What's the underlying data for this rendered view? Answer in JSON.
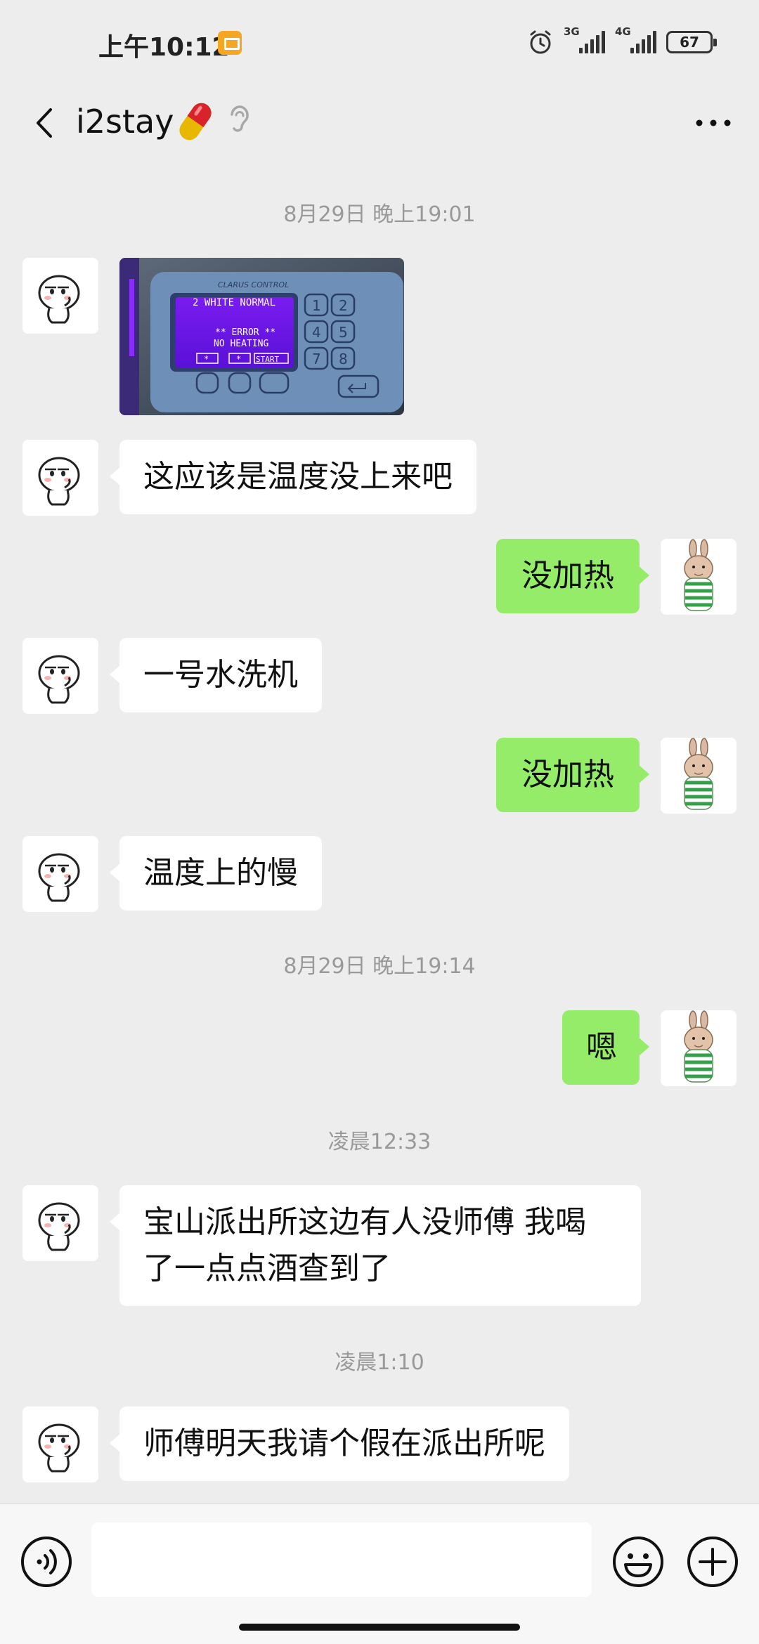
{
  "status_bar": {
    "time": "上午10:12",
    "signal1_label": "3G",
    "signal2_label": "4G",
    "battery": "67"
  },
  "header": {
    "title": "i2stay",
    "title_icons": [
      "pill-icon",
      "ear-icon"
    ]
  },
  "photo": {
    "panel_brand": "CLARUS CONTROL",
    "screen_line1": "2 WHITE  NORMAL",
    "screen_line2": "** ERROR **",
    "screen_line3": "NO HEATING",
    "soft_key1": "*",
    "soft_key2": "*",
    "soft_key3": "START",
    "keys": [
      "1",
      "2",
      "4",
      "5",
      "7",
      "8"
    ]
  },
  "messages": {
    "ts1": "8月29日 晚上19:01",
    "m2": "这应该是温度没上来吧",
    "m3": "没加热",
    "m4": "一号水洗机",
    "m5": "没加热",
    "m6": "温度上的慢",
    "ts2": "8月29日 晚上19:14",
    "m7": "嗯",
    "ts3": "凌晨12:33",
    "m8_line1": "宝山派出所这边有人没师傅 我喝",
    "m8_line2": "了一点点酒查到了",
    "ts4": "凌晨1:10",
    "m9": "师傅明天我请个假在派出所呢"
  },
  "input": {
    "placeholder": ""
  },
  "colors": {
    "background": "#ededed",
    "incoming_bubble": "#ffffff",
    "outgoing_bubble": "#95ec69",
    "timestamp_text": "#999999"
  }
}
